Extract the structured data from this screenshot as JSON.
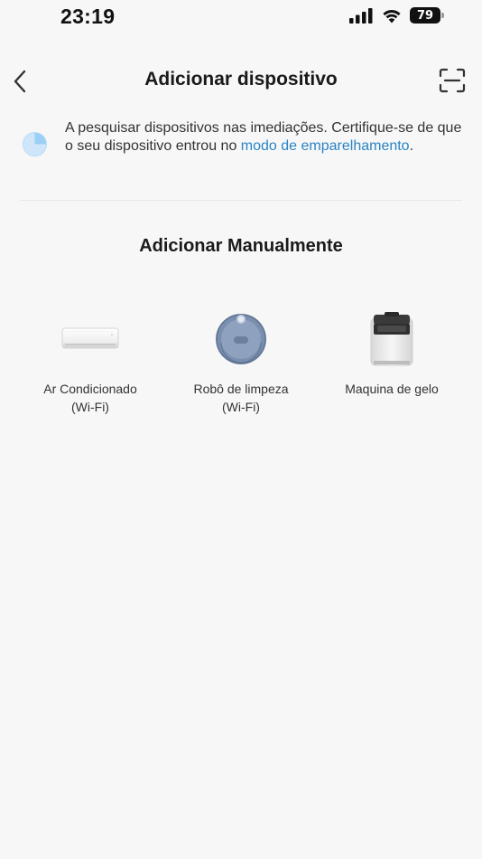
{
  "status_bar": {
    "time": "23:19",
    "battery_level": "79",
    "signal_icon": "cellular-signal-icon",
    "wifi_icon": "wifi-icon"
  },
  "nav": {
    "title": "Adicionar dispositivo",
    "back_icon": "chevron-left-icon",
    "scan_icon": "scan-icon"
  },
  "search": {
    "text_before_link": "A pesquisar dispositivos nas imediações. Certifique-se de que o seu dispositivo entrou no ",
    "link_text": "modo de emparelhamento",
    "text_after_link": ".",
    "icon": "radar-search-icon",
    "accent_color": "#2a84c6"
  },
  "manual": {
    "title": "Adicionar Manualmente",
    "devices": [
      {
        "label_line1": "Ar Condicionado",
        "label_line2": "(Wi-Fi)",
        "icon": "air-conditioner-icon"
      },
      {
        "label_line1": "Robô de limpeza",
        "label_line2": "(Wi-Fi)",
        "icon": "robot-vacuum-icon"
      },
      {
        "label_line1": "Maquina de gelo",
        "label_line2": "",
        "icon": "ice-machine-icon"
      }
    ]
  }
}
